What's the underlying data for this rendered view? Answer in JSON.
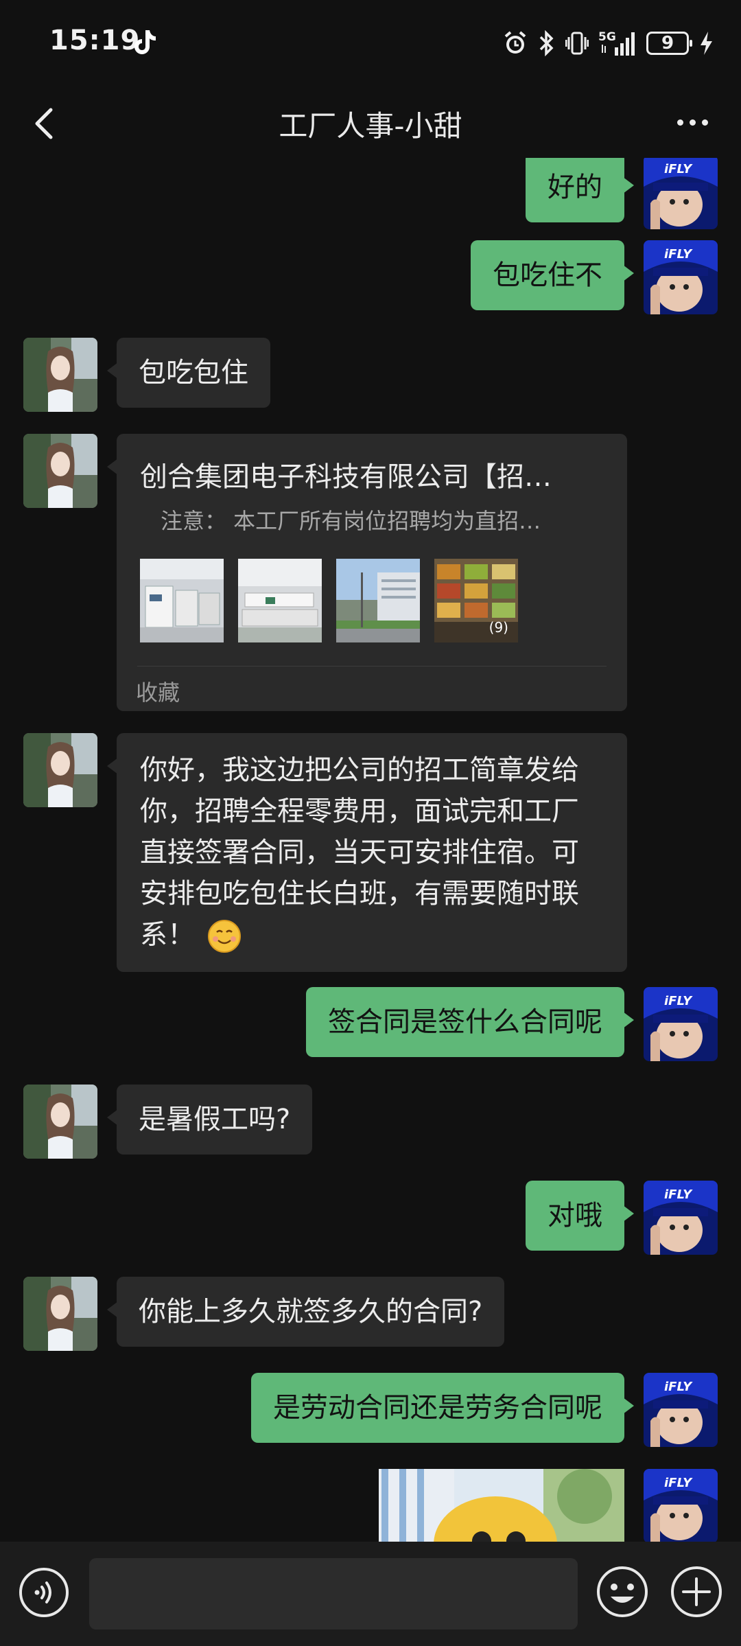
{
  "status": {
    "time": "15:19",
    "network": "5G",
    "battery": "9"
  },
  "header": {
    "title": "工厂人事-小甜"
  },
  "messages": [
    {
      "side": "sent",
      "text": "好的"
    },
    {
      "side": "sent",
      "text": "包吃住不"
    },
    {
      "side": "recv",
      "text": "包吃包住"
    },
    {
      "side": "recv",
      "type": "link-card",
      "card": {
        "title": "创合集团电子科技有限公司【招…",
        "subtitle": "注意： 本工厂所有岗位招聘均为直招…",
        "images": [
          "factory-floor-1",
          "factory-floor-2",
          "factory-exterior",
          "canteen-food"
        ],
        "image_count": "(9)",
        "source": "收藏"
      }
    },
    {
      "side": "recv",
      "text": "你好，我这边把公司的招工简章发给你，招聘全程零费用，面试完和工厂直接签署合同，当天可安排住宿。可安排包吃包住长白班，有需要随时联系！"
    },
    {
      "side": "sent",
      "text": "签合同是签什么合同呢"
    },
    {
      "side": "recv",
      "text": "是暑假工吗?"
    },
    {
      "side": "sent",
      "text": "对哦"
    },
    {
      "side": "recv",
      "text": "你能上多久就签多久的合同?"
    },
    {
      "side": "sent",
      "text": "是劳动合同还是劳务合同呢"
    },
    {
      "side": "sent",
      "type": "image",
      "image": "cartoon-sticker"
    }
  ],
  "avatars": {
    "self_badge": "iFLY"
  },
  "input": {
    "placeholder": ""
  },
  "icons": [
    "back-arrow-icon",
    "more-icon",
    "voice-icon",
    "emoji-icon",
    "plus-icon"
  ],
  "colors": {
    "sent_bubble": "#5fb878",
    "recv_bubble": "#2a2a2a",
    "background": "#111111"
  }
}
